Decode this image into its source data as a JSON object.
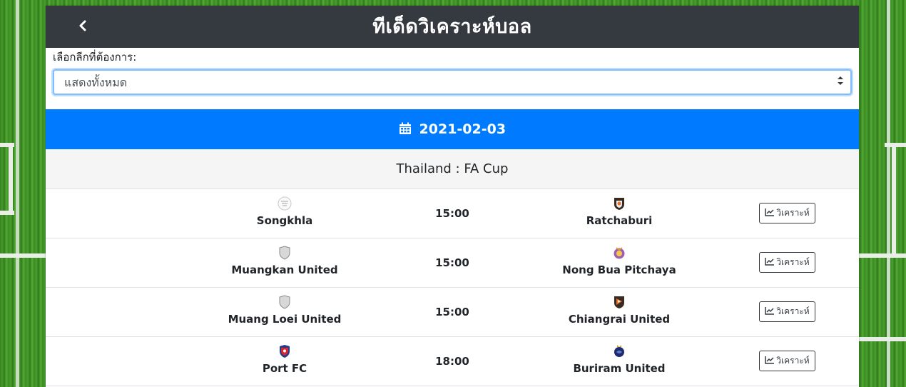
{
  "header": {
    "title": "ทีเด็ดวิเคราะห์บอล",
    "back_icon": "chevron-left-icon"
  },
  "filter": {
    "label": "เลือกลีกที่ต้องการ:",
    "selected": "แสดงทั้งหมด"
  },
  "date": {
    "value": "2021-02-03",
    "icon": "calendar-icon"
  },
  "league": {
    "name": "Thailand : FA Cup"
  },
  "colors": {
    "header_bg": "#343a40",
    "date_bar_bg": "#007bff",
    "league_bar_bg": "#f5f5f5"
  },
  "matches": [
    {
      "home": "Songkhla",
      "time": "15:00",
      "away": "Ratchaburi",
      "button": "วิเคราะห์",
      "home_logo": "songkhla-logo",
      "away_logo": "ratchaburi-logo"
    },
    {
      "home": "Muangkan United",
      "time": "15:00",
      "away": "Nong Bua Pitchaya",
      "button": "วิเคราะห์",
      "home_logo": "default-shield-logo",
      "away_logo": "nong-bua-pitchaya-logo"
    },
    {
      "home": "Muang Loei United",
      "time": "15:00",
      "away": "Chiangrai United",
      "button": "วิเคราะห์",
      "home_logo": "default-shield-logo",
      "away_logo": "chiangrai-united-logo"
    },
    {
      "home": "Port FC",
      "time": "18:00",
      "away": "Buriram United",
      "button": "วิเคราะห์",
      "home_logo": "port-fc-logo",
      "away_logo": "buriram-united-logo"
    }
  ]
}
